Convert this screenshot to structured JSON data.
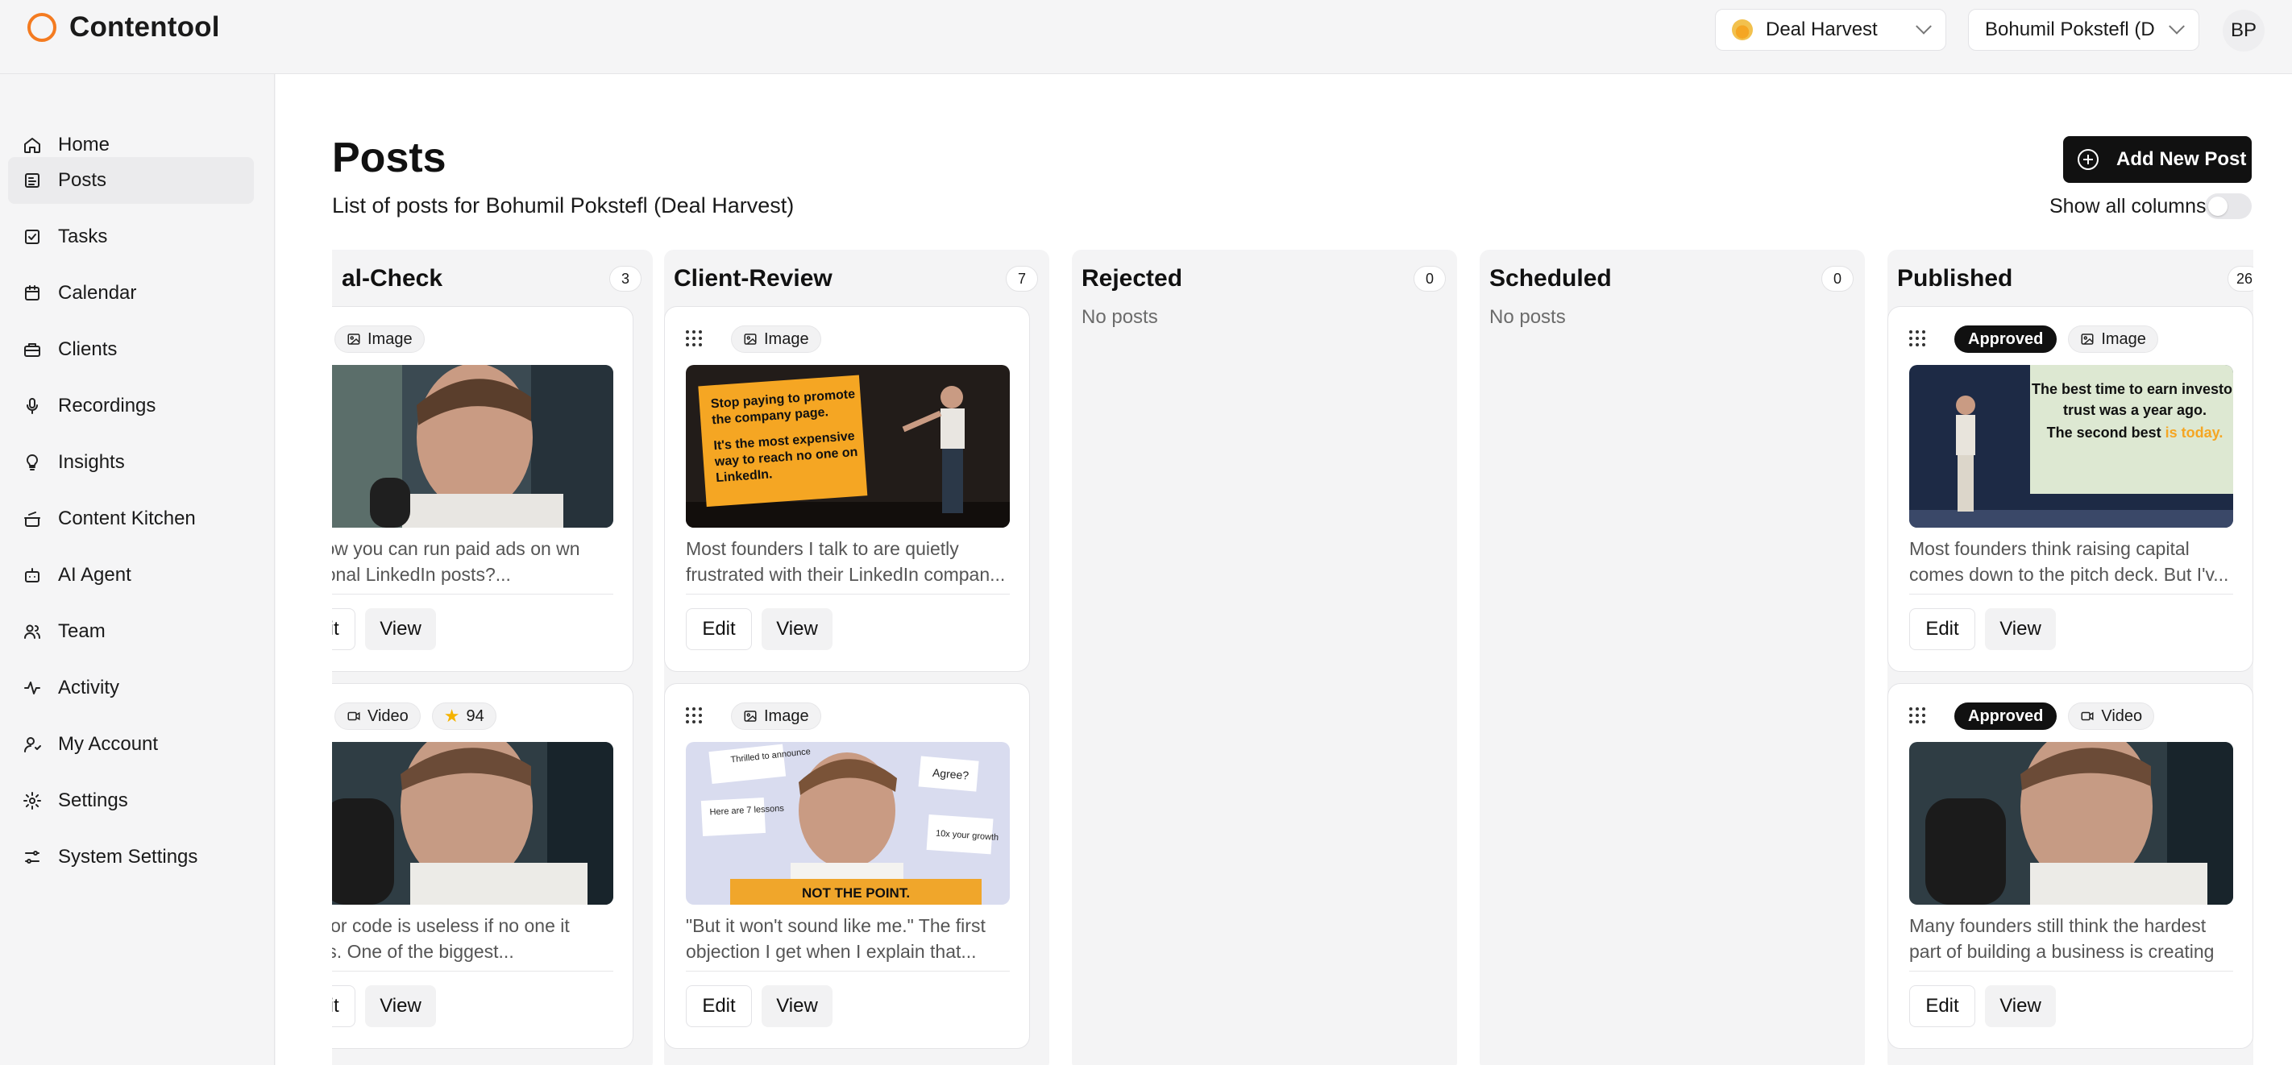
{
  "app": {
    "name": "Contentool"
  },
  "header": {
    "org_select": "Deal Harvest",
    "user_select": "Bohumil Pokstefl (Deal Harvest)",
    "avatar_initials": "BP"
  },
  "sidebar": {
    "items": [
      {
        "label": "Home",
        "icon": "home-icon"
      },
      {
        "label": "Posts",
        "icon": "posts-icon",
        "active": true
      },
      {
        "label": "Tasks",
        "icon": "tasks-icon"
      },
      {
        "label": "Calendar",
        "icon": "calendar-icon"
      },
      {
        "label": "Clients",
        "icon": "clients-icon"
      },
      {
        "label": "Recordings",
        "icon": "microphone-icon"
      },
      {
        "label": "Insights",
        "icon": "lightbulb-icon"
      },
      {
        "label": "Content Kitchen",
        "icon": "kitchen-icon"
      },
      {
        "label": "AI Agent",
        "icon": "robot-icon"
      },
      {
        "label": "Team",
        "icon": "team-icon"
      },
      {
        "label": "Activity",
        "icon": "activity-icon"
      },
      {
        "label": "My Account",
        "icon": "user-icon"
      },
      {
        "label": "Settings",
        "icon": "gear-icon"
      },
      {
        "label": "System Settings",
        "icon": "sliders-icon"
      }
    ]
  },
  "page": {
    "title": "Posts",
    "subtitle": "List of posts for Bohumil Pokstefl (Deal Harvest)",
    "add_button": "Add New Post",
    "show_all_columns": "Show all columns"
  },
  "columns": [
    {
      "title": "al-Check",
      "count": "3",
      "cards": [
        {
          "tags": [
            "Image"
          ],
          "text": "u know you can run paid ads on wn personal LinkedIn posts?..."
        },
        {
          "tags": [
            "Video",
            "94"
          ],
          "text": "uperior code is useless if no one it exists. One of the biggest..."
        }
      ]
    },
    {
      "title": "Client-Review",
      "count": "7",
      "cards": [
        {
          "tags": [
            "Image"
          ],
          "text": "Most founders I talk to are quietly frustrated with their LinkedIn compan...",
          "sign": [
            "Stop paying to promote",
            "the company page.",
            "It's the most expensive",
            "way to reach no one on",
            "LinkedIn."
          ]
        },
        {
          "tags": [
            "Image"
          ],
          "text": "\"But it won't sound like me.\" The first objection I get when I explain that...",
          "stickers": [
            "Thrilled to announce",
            "Agree?",
            "Here are 7 lessons",
            "10x your growth"
          ],
          "banner": "NOT THE POINT."
        }
      ]
    },
    {
      "title": "Rejected",
      "count": "0",
      "empty": "No posts"
    },
    {
      "title": "Scheduled",
      "count": "0",
      "empty": "No posts"
    },
    {
      "title": "Published",
      "count": "26",
      "cards": [
        {
          "tags": [
            "Approved",
            "Image"
          ],
          "text": "Most founders think raising capital comes down to the pitch deck. But I'v...",
          "slide": [
            "The best time to earn investor",
            "trust was a year ago.",
            "The second best ",
            "is today."
          ]
        },
        {
          "tags": [
            "Approved",
            "Video"
          ],
          "text": "Many founders still think the hardest part of building a business is creating ..."
        }
      ]
    }
  ],
  "buttons": {
    "edit": "Edit",
    "view": "View"
  },
  "colors": {
    "brand": "#f47b20",
    "primary_button": "#111111",
    "sign": "#f5a623"
  }
}
